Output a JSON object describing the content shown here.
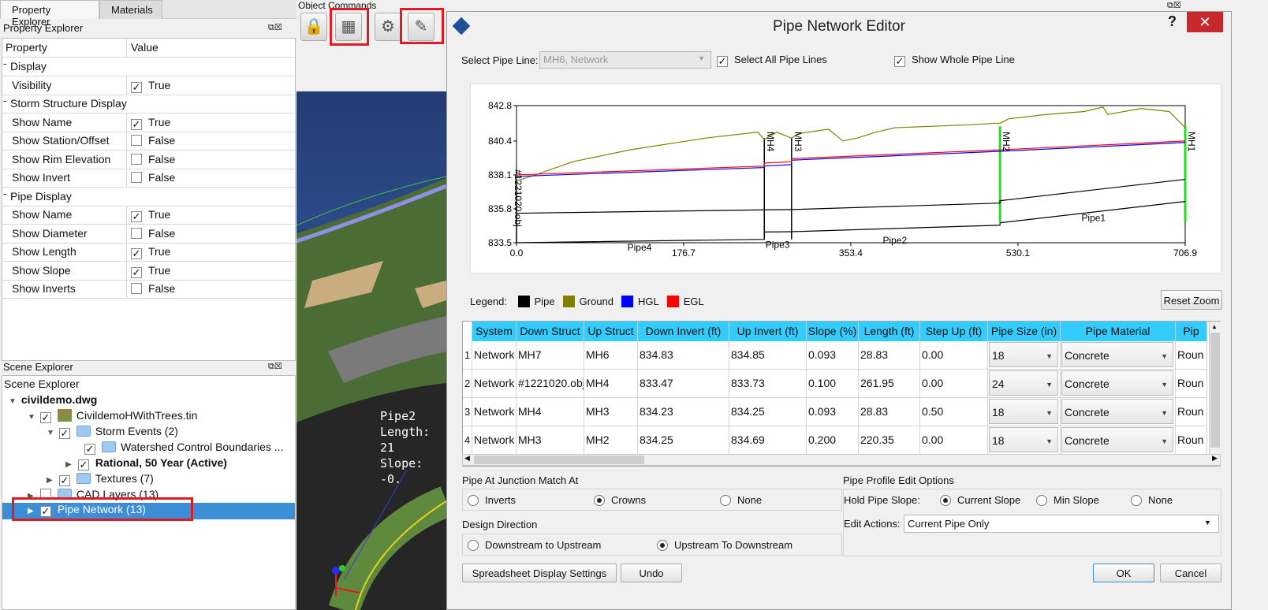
{
  "left_panel": {
    "tabs": [
      "Property Explorer",
      "Materials"
    ],
    "property_explorer": {
      "title": "Property Explorer",
      "col_property": "Property",
      "col_value": "Value",
      "rows": [
        {
          "type": "group",
          "label": "Display"
        },
        {
          "type": "prop",
          "label": "Visibility",
          "checked": true,
          "value": "True"
        },
        {
          "type": "group",
          "label": "Storm Structure Display"
        },
        {
          "type": "prop",
          "label": "Show Name",
          "checked": true,
          "value": "True"
        },
        {
          "type": "prop",
          "label": "Show Station/Offset",
          "checked": false,
          "value": "False"
        },
        {
          "type": "prop",
          "label": "Show Rim Elevation",
          "checked": false,
          "value": "False"
        },
        {
          "type": "prop",
          "label": "Show Invert",
          "checked": false,
          "value": "False"
        },
        {
          "type": "group",
          "label": "Pipe Display"
        },
        {
          "type": "prop",
          "label": "Show Name",
          "checked": true,
          "value": "True"
        },
        {
          "type": "prop",
          "label": "Show Diameter",
          "checked": false,
          "value": "False"
        },
        {
          "type": "prop",
          "label": "Show Length",
          "checked": true,
          "value": "True"
        },
        {
          "type": "prop",
          "label": "Show Slope",
          "checked": true,
          "value": "True"
        },
        {
          "type": "prop",
          "label": "Show Inverts",
          "checked": false,
          "value": "False"
        }
      ]
    },
    "scene_explorer": {
      "title": "Scene Explorer",
      "header": "Scene Explorer",
      "file": "civildemo.dwg",
      "items": [
        "CivildemoHWithTrees.tin",
        "Storm Events (2)",
        "Watershed Control Boundaries ...",
        "Rational, 50 Year (Active)",
        "Textures (7)",
        "CAD Layers (13)",
        "Pipe Network (13)"
      ]
    }
  },
  "object_commands": {
    "label": "Object Commands"
  },
  "viewport": {
    "pipe_label": "Pipe2",
    "length_label": "Length: 21",
    "slope_label": "Slope: -0."
  },
  "dialog": {
    "title": "Pipe Network Editor",
    "help": "?",
    "close": "✕",
    "select_pipe_line_label": "Select Pipe Line:",
    "select_pipe_line_value": "MH6, Network",
    "select_all_label": "Select All Pipe Lines",
    "show_whole_label": "Show Whole Pipe Line",
    "legend_label": "Legend:",
    "legend": [
      {
        "name": "Pipe",
        "color": "#000000"
      },
      {
        "name": "Ground",
        "color": "#808000"
      },
      {
        "name": "HGL",
        "color": "#0000ff"
      },
      {
        "name": "EGL",
        "color": "#ff0000"
      }
    ],
    "reset_zoom": "Reset Zoom",
    "grid": {
      "headers": [
        "System",
        "Down Struct",
        "Up Struct",
        "Down Invert (ft)",
        "Up Invert (ft)",
        "Slope (%)",
        "Length (ft)",
        "Step Up (ft)",
        "Pipe Size (in)",
        "Pipe Material",
        "Pip"
      ],
      "rows": [
        [
          "1",
          "Network",
          "MH7",
          "MH6",
          "834.83",
          "834.85",
          "0.093",
          "28.83",
          "0.00",
          "18",
          "Concrete",
          "Roun"
        ],
        [
          "2",
          "Network",
          "#1221020.obj",
          "MH4",
          "833.47",
          "833.73",
          "0.100",
          "261.95",
          "0.00",
          "24",
          "Concrete",
          "Roun"
        ],
        [
          "3",
          "Network",
          "MH4",
          "MH3",
          "834.23",
          "834.25",
          "0.093",
          "28.83",
          "0.50",
          "18",
          "Concrete",
          "Roun"
        ],
        [
          "4",
          "Network",
          "MH3",
          "MH2",
          "834.25",
          "834.69",
          "0.200",
          "220.35",
          "0.00",
          "18",
          "Concrete",
          "Roun"
        ]
      ]
    },
    "junction": {
      "label": "Pipe At Junction Match At",
      "options": [
        "Inverts",
        "Crowns",
        "None"
      ],
      "selected": "Crowns"
    },
    "design_direction": {
      "label": "Design Direction",
      "options": [
        "Downstream to Upstream",
        "Upstream To Downstream"
      ],
      "selected": "Upstream To Downstream"
    },
    "profile_edit": {
      "label": "Pipe Profile Edit Options",
      "hold_slope_label": "Hold Pipe Slope:",
      "slope_options": [
        "Current Slope",
        "Min Slope",
        "None"
      ],
      "selected": "Current Slope",
      "edit_actions_label": "Edit Actions:",
      "edit_actions_value": "Current Pipe Only"
    },
    "buttons": {
      "spreadsheet": "Spreadsheet Display Settings",
      "undo": "Undo",
      "ok": "OK",
      "cancel": "Cancel"
    }
  },
  "chart_data": {
    "type": "line",
    "xlim": [
      0,
      706.9
    ],
    "ylim": [
      833.5,
      842.8
    ],
    "x_ticks": [
      "0.0",
      "176.7",
      "353.4",
      "530.1",
      "706.9"
    ],
    "y_ticks": [
      "842.8",
      "840.4",
      "838.1",
      "835.8",
      "833.5"
    ],
    "structures": [
      {
        "name": "#1221020.obj",
        "x": 0
      },
      {
        "name": "MH4",
        "x": 261.95
      },
      {
        "name": "MH3",
        "x": 290.78
      },
      {
        "name": "MH2",
        "x": 511.13
      },
      {
        "name": "MH1",
        "x": 706.9
      }
    ],
    "pipe_labels": [
      {
        "name": "Pipe4",
        "x": 130,
        "y": 833.6
      },
      {
        "name": "Pipe3",
        "x": 276,
        "y": 833.8
      },
      {
        "name": "Pipe2",
        "x": 400,
        "y": 834.1
      },
      {
        "name": "Pipe1",
        "x": 610,
        "y": 835.6
      }
    ],
    "series": [
      {
        "name": "Ground",
        "color": "#808000",
        "x": [
          0,
          20,
          60,
          120,
          200,
          255,
          261.95,
          275,
          290.78,
          298,
          330,
          345,
          360,
          380,
          400,
          440,
          480,
          505,
          511.13,
          520,
          560,
          600,
          620,
          625,
          660,
          690,
          706.9
        ],
        "y": [
          837.7,
          838.1,
          839.0,
          839.8,
          840.6,
          841.0,
          840.5,
          841.0,
          840.6,
          840.9,
          841.2,
          840.4,
          840.6,
          841.0,
          841.3,
          841.4,
          841.5,
          841.6,
          841.6,
          841.9,
          842.2,
          842.4,
          842.7,
          842.2,
          842.6,
          842.4,
          841.3
        ]
      },
      {
        "name": "HGL",
        "color": "#0000ff",
        "x": [
          0,
          261.95,
          261.95,
          290.78,
          290.78,
          511.13,
          511.13,
          706.9
        ],
        "y": [
          838.0,
          838.6,
          838.7,
          838.8,
          839.1,
          839.7,
          839.7,
          840.3
        ]
      },
      {
        "name": "EGL",
        "color": "#ff0000",
        "x": [
          0,
          261.95,
          261.95,
          290.78,
          290.78,
          511.13,
          511.13,
          706.9
        ],
        "y": [
          838.1,
          838.7,
          838.9,
          839.0,
          839.2,
          839.8,
          839.8,
          840.4
        ]
      },
      {
        "name": "Pipe invert",
        "color": "#000000",
        "x": [
          0,
          261.95,
          261.95,
          290.78,
          290.78,
          511.13,
          511.13,
          706.9
        ],
        "y": [
          833.5,
          833.73,
          834.23,
          834.25,
          834.25,
          834.69,
          834.85,
          836.3
        ]
      },
      {
        "name": "Pipe crown",
        "color": "#000000",
        "x": [
          0,
          261.95,
          261.95,
          290.78,
          290.78,
          511.13,
          511.13,
          706.9
        ],
        "y": [
          835.5,
          835.73,
          835.73,
          835.75,
          835.75,
          836.19,
          836.35,
          837.8
        ]
      }
    ],
    "green_structures_x": [
      511.13,
      706.9
    ]
  }
}
